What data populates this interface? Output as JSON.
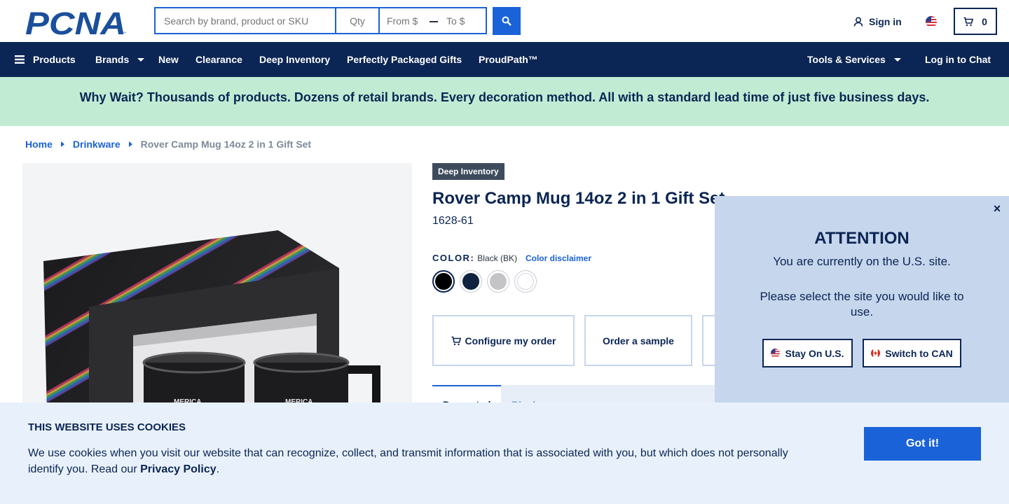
{
  "header": {
    "logo_text": "PCNA",
    "search_placeholder": "Search by brand, product or SKU",
    "qty_placeholder": "Qty",
    "price_from_placeholder": "From $",
    "price_to_placeholder": "To $",
    "signin_label": "Sign in",
    "cart_count": "0"
  },
  "nav": {
    "left": [
      {
        "label": "Products"
      },
      {
        "label": "Brands"
      },
      {
        "label": "New"
      },
      {
        "label": "Clearance"
      },
      {
        "label": "Deep Inventory"
      },
      {
        "label": "Perfectly Packaged Gifts"
      },
      {
        "label": "ProudPath™"
      }
    ],
    "tools_label": "Tools & Services",
    "chat_label": "Log in to Chat"
  },
  "promo": {
    "text": "Why Wait? Thousands of products. Dozens of retail brands. Every decoration method. All with a standard lead time of just five business days."
  },
  "breadcrumb": {
    "items": [
      "Home",
      "Drinkware"
    ],
    "current": "Rover Camp Mug 14oz 2 in 1 Gift Set"
  },
  "product": {
    "badge": "Deep Inventory",
    "title": "Rover Camp Mug 14oz 2 in 1 Gift Set",
    "sku": "1628-61",
    "color_label": "COLOR:",
    "color_value": "Black (BK)",
    "color_disclaimer": "Color disclaimer",
    "swatches": [
      "#000000",
      "#0f2240",
      "#c4c4c6",
      "#ffffff"
    ],
    "mug_print": "MERICA",
    "actions": {
      "configure": "Configure my order",
      "sample": "Order a sample"
    },
    "tabs": [
      "Decorated",
      "Blank"
    ]
  },
  "attention": {
    "heading": "ATTENTION",
    "line1": "You are currently on the U.S. site.",
    "line2": "Please select the site you would like to use.",
    "stay_label": "Stay On U.S.",
    "switch_label": "Switch to CAN",
    "close_symbol": "×"
  },
  "cookie": {
    "heading": "THIS WEBSITE USES COOKIES",
    "text": "We use cookies when you visit our website that can recognize, collect, and transmit information that is associated with you, but which does not personally identify you. Read our ",
    "link": "Privacy Policy",
    "text_end": ".",
    "button": "Got it!"
  },
  "colors": {
    "navy": "#0b2554",
    "accent_blue": "#1a62d8",
    "promo_green": "#c1ecd3",
    "popup_blue": "#c6d6ec",
    "cookie_bg": "#e8f1fb"
  }
}
